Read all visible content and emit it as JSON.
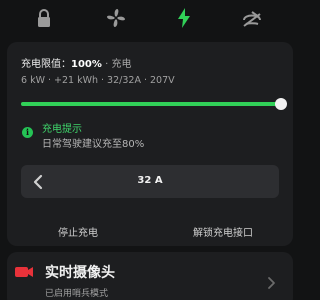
{
  "nav": {
    "icons": [
      "lock-icon",
      "fan-icon",
      "charging-bolt-icon",
      "tire-pressure-icon"
    ],
    "active": "charging-bolt-icon"
  },
  "charging": {
    "limit_label": "充电限值：",
    "limit_value": "100%",
    "dot": "·",
    "status": "充电",
    "stats": "6 kW · +21 kWh · 32/32A · 207V",
    "limit_percent": 100,
    "tip_title": "充电提示",
    "tip_text": "日常驾驶建议充至80%",
    "amps": "32 A",
    "stop_label": "停止充电",
    "unlock_label": "解锁充电接口"
  },
  "camera": {
    "title": "实时摄像头",
    "subtitle": "已启用哨兵模式"
  },
  "colors": {
    "accent_green": "#31d158",
    "camera_red": "#e8323a",
    "background": "#121314",
    "card": "#1d1e20"
  }
}
